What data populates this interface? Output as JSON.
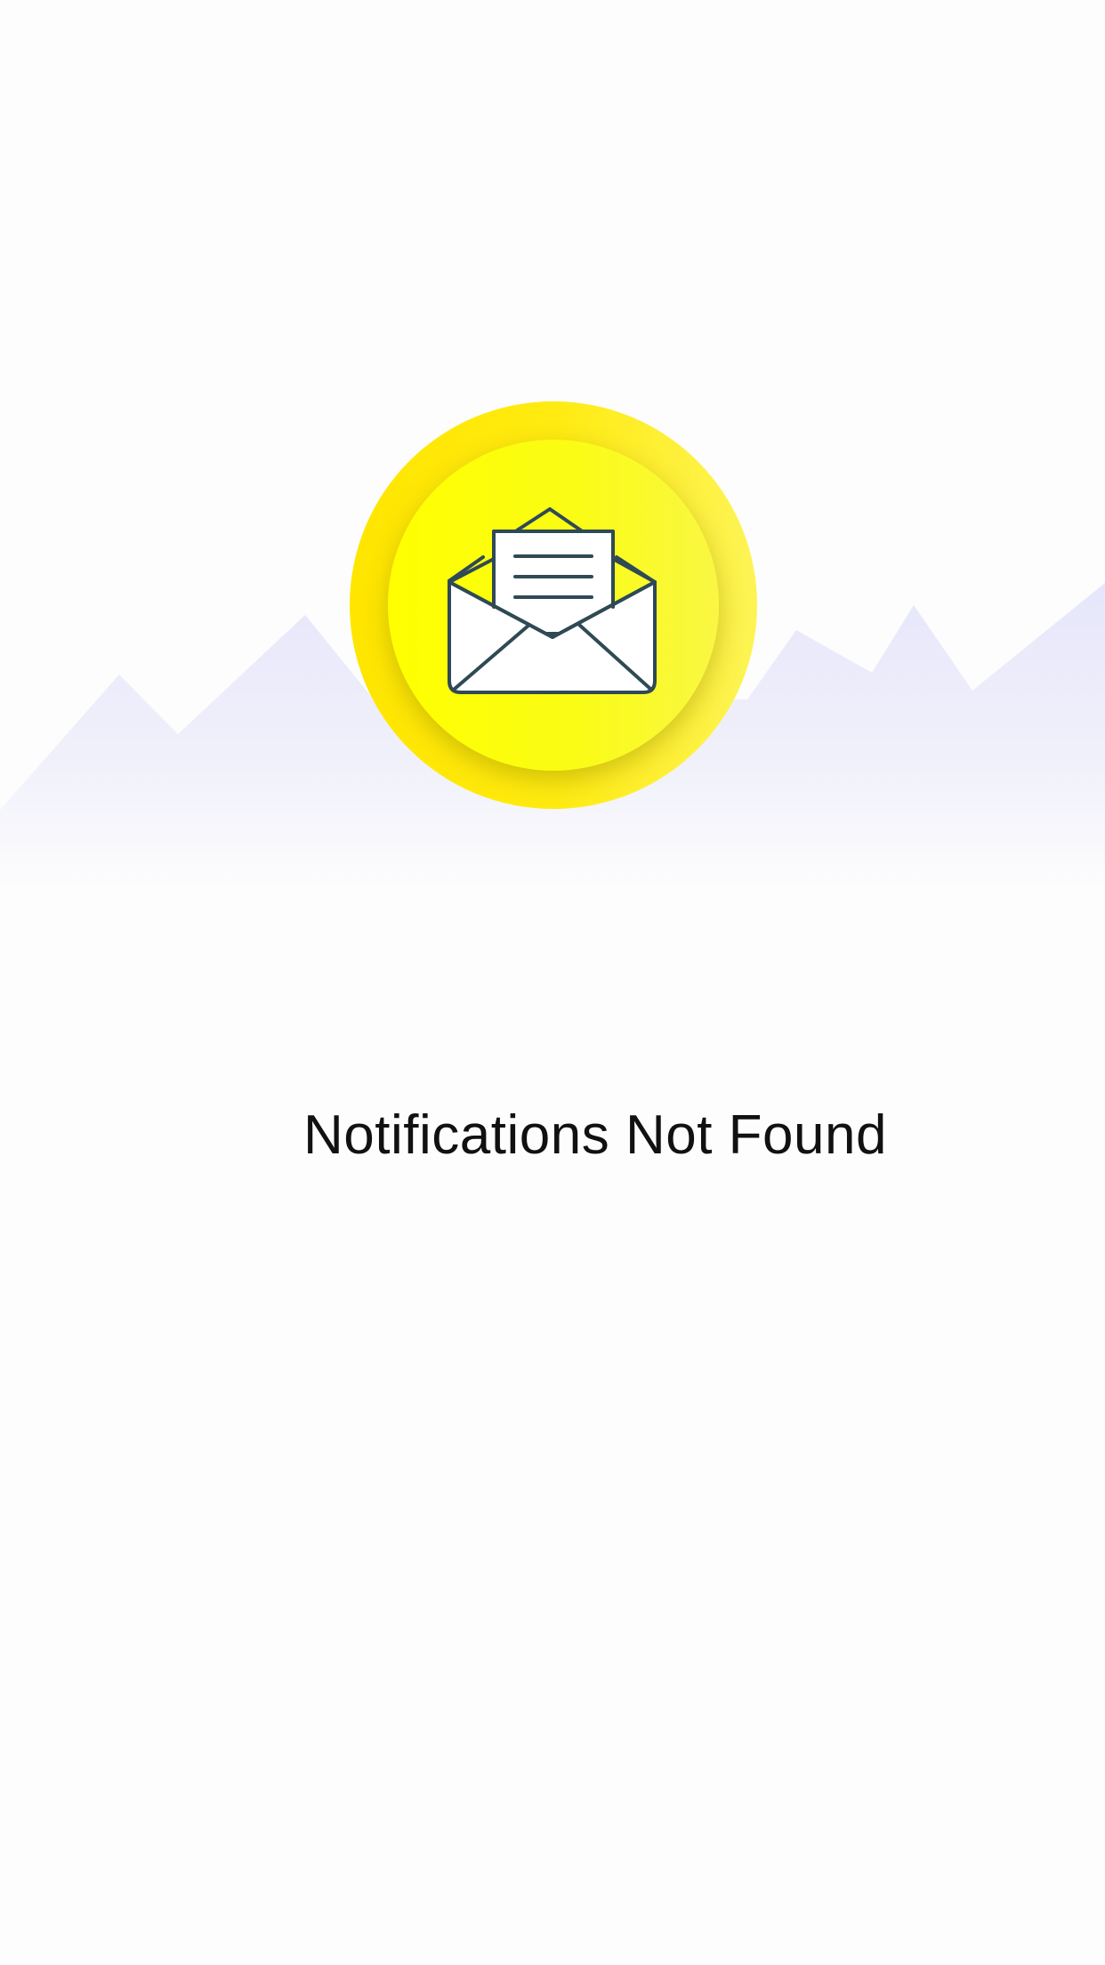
{
  "empty_state": {
    "title": "Notifications Not Found",
    "illustration": {
      "icon": "open-envelope-icon",
      "background": "mountain-silhouette",
      "badge_color": "#ffff00",
      "mountain_color": "#e8e8fb",
      "icon_stroke_color": "#2f4a55"
    }
  }
}
